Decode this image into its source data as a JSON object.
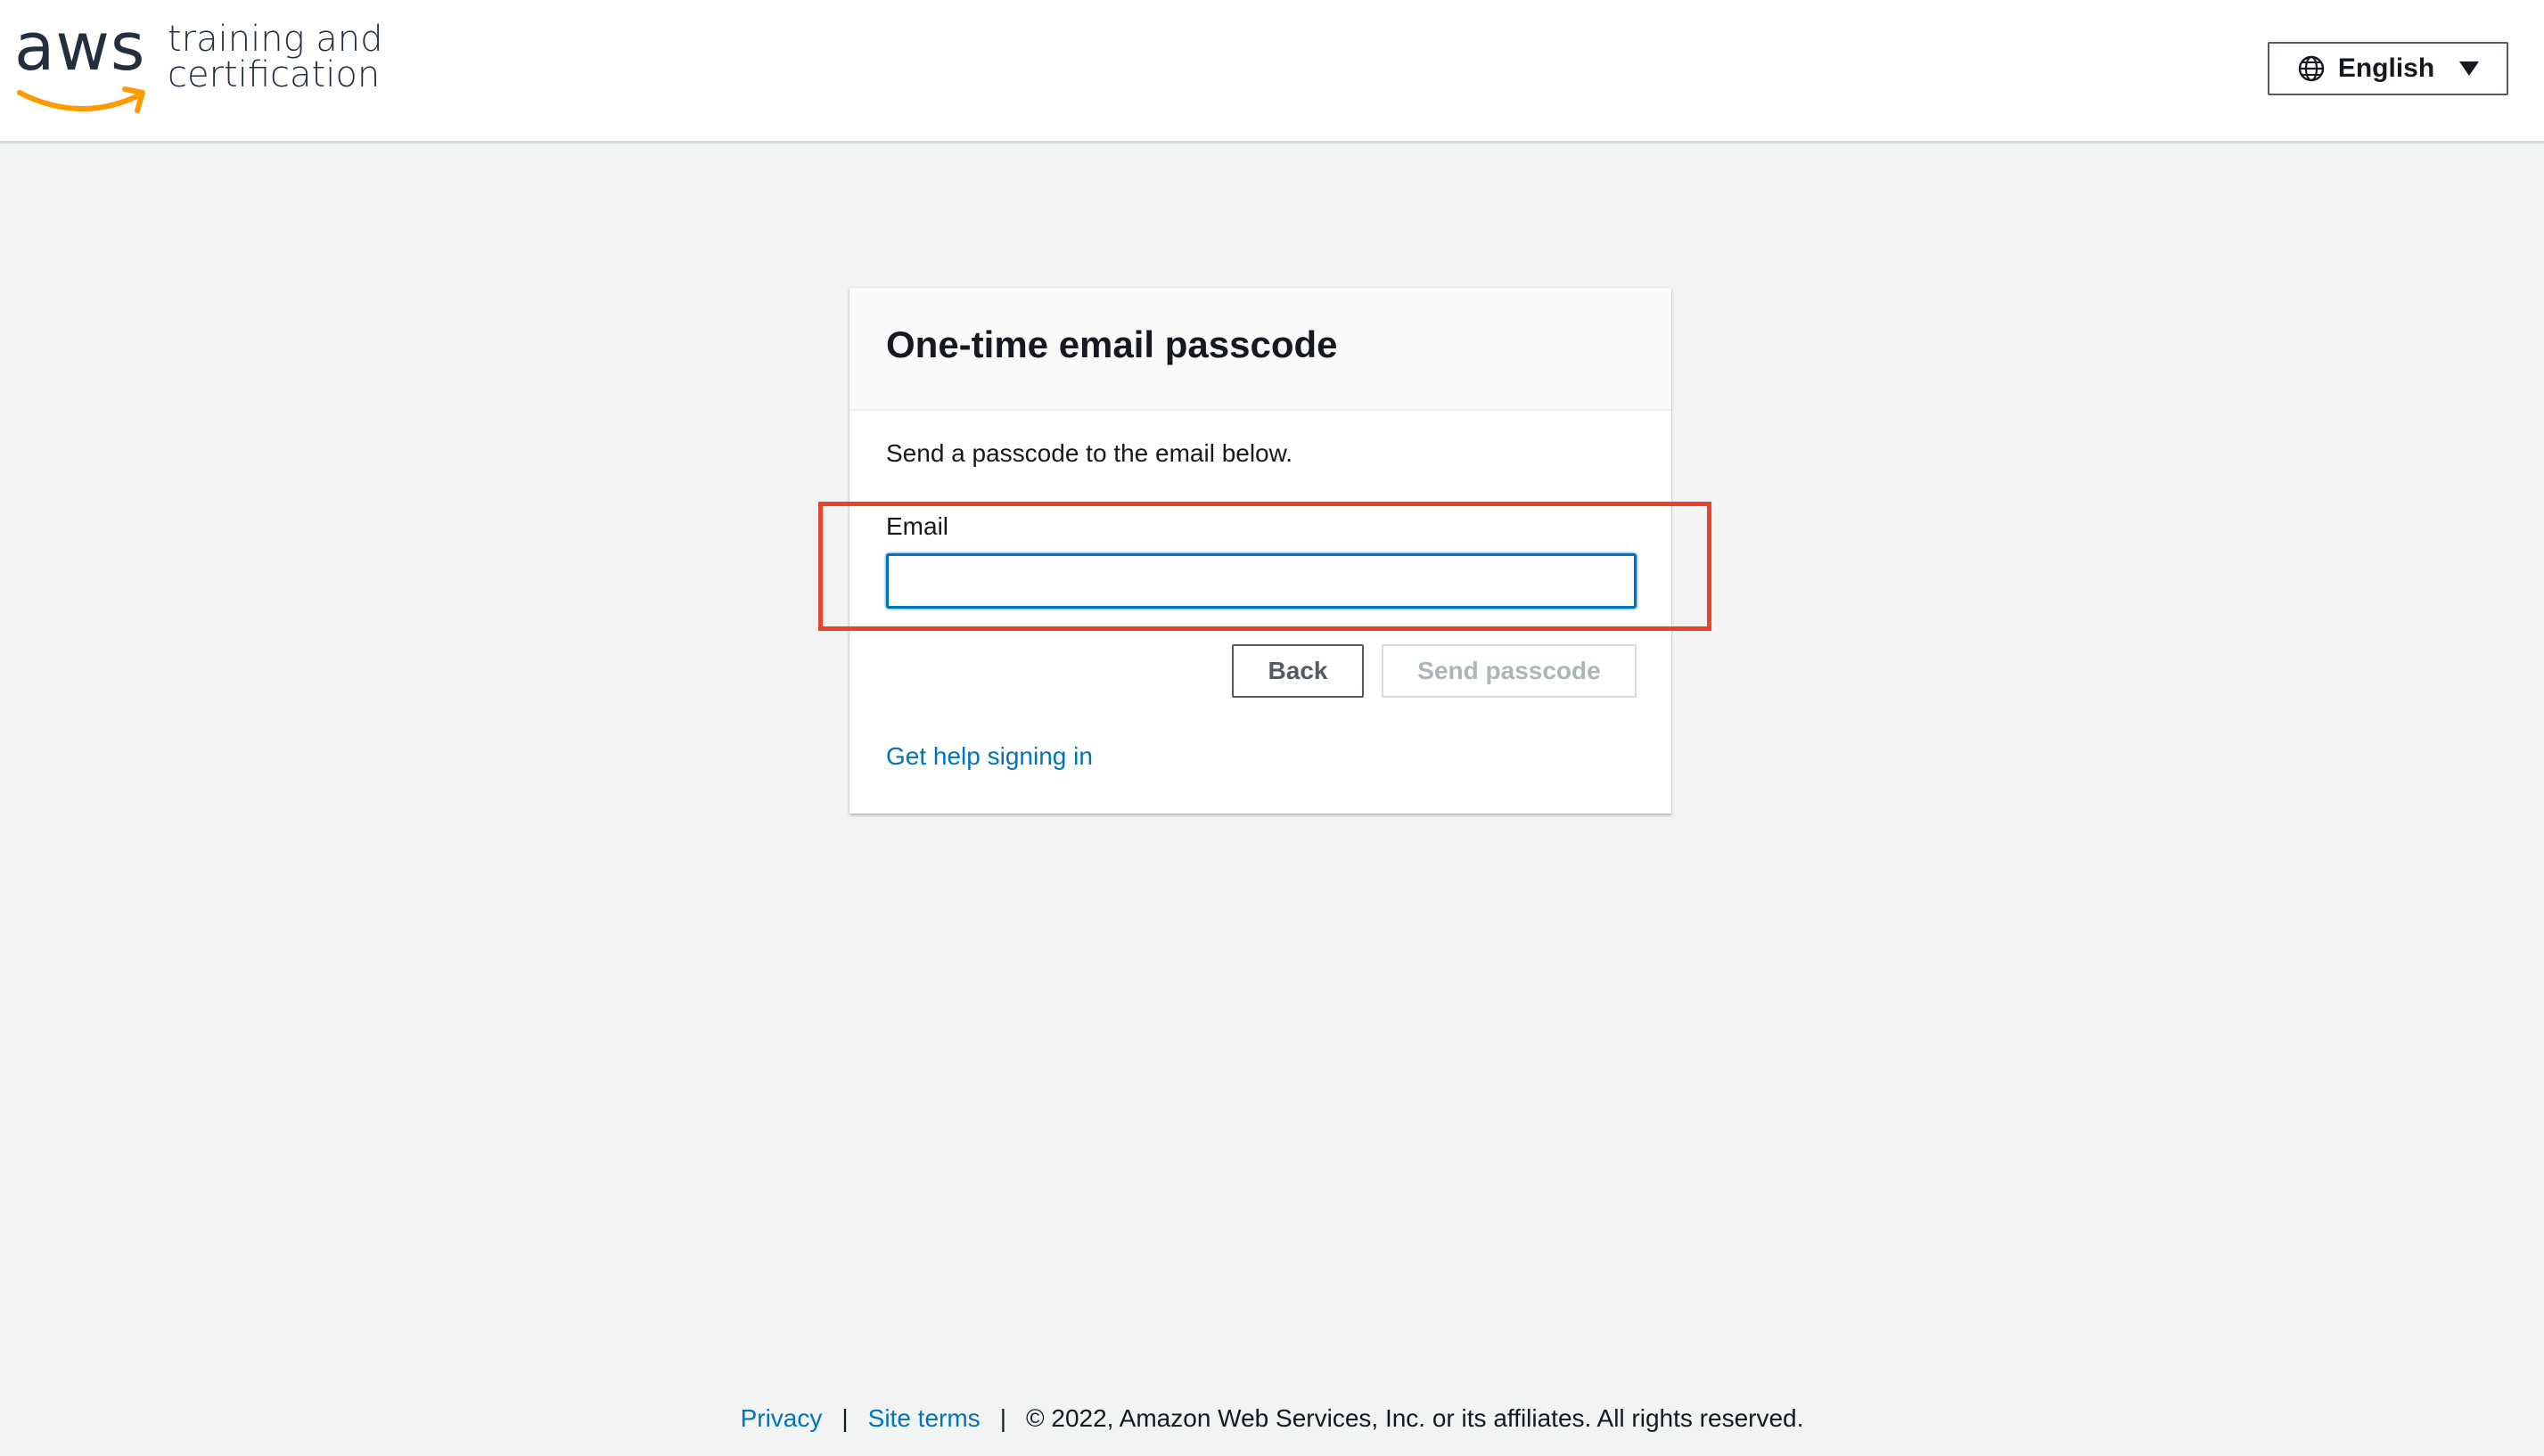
{
  "header": {
    "logo_mark": "aws",
    "logo_line1": "training and",
    "logo_line2": "certification",
    "language": {
      "label": "English",
      "icon": "globe-icon"
    }
  },
  "card": {
    "title": "One-time email passcode",
    "description": "Send a passcode to the email below.",
    "email": {
      "label": "Email",
      "value": "",
      "placeholder": ""
    },
    "back_label": "Back",
    "send_label": "Send passcode",
    "help_link": "Get help signing in"
  },
  "footer": {
    "privacy": "Privacy",
    "separator": "|",
    "site_terms": "Site terms",
    "copyright": "© 2022, Amazon Web Services, Inc. or its affiliates. All rights reserved."
  },
  "colors": {
    "link": "#0073bb",
    "highlight": "#e8432b",
    "aws_orange": "#f90",
    "background": "#f2f3f3"
  }
}
